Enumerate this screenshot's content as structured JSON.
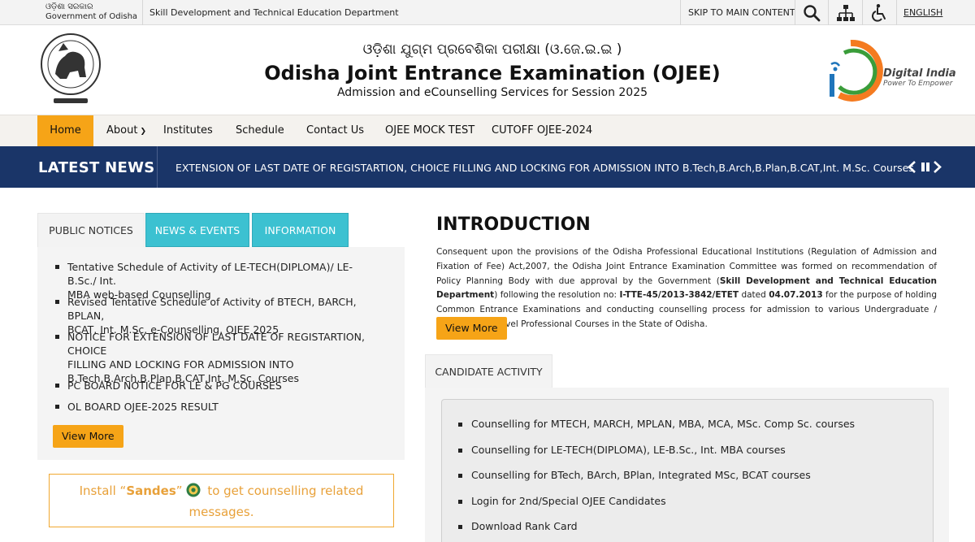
{
  "topbar": {
    "gov_odia": "ଓଡ଼ିଶା ସରକାର",
    "gov_en": "Government of Odisha",
    "department": "Skill Development and Technical Education Department",
    "skip": "SKIP TO MAIN CONTENT",
    "language": "ENGLISH",
    "icons": [
      "search-icon",
      "sitemap-icon",
      "accessibility-icon"
    ]
  },
  "header": {
    "title_odia": "ଓଡ଼ିଶା ଯୁଗ୍ମ ପ୍ରବେଶିକା ପରୀକ୍ଷା (ଓ.ଜେ.ଇ.ଇ )",
    "title": "Odisha Joint Entrance Examination (OJEE)",
    "subtitle": "Admission and eCounselling Services for Session 2025",
    "digital_india": "Digital India",
    "digital_india_tag": "Power To Empower"
  },
  "nav": {
    "items": [
      "Home",
      "About",
      "Institutes",
      "Schedule",
      "Contact Us",
      "OJEE MOCK TEST",
      "CUTOFF OJEE-2024"
    ],
    "active": "Home"
  },
  "ticker": {
    "label": "LATEST NEWS",
    "text": "EXTENSION OF LAST DATE OF REGISTARTION, CHOICE FILLING AND LOCKING FOR ADMISSION INTO B.Tech,B.Arch,B.Plan,B.CAT,Int. M.Sc. Courses",
    "controls": [
      "prev-icon",
      "pause-icon",
      "next-icon"
    ]
  },
  "left": {
    "tabs": [
      "PUBLIC NOTICES",
      "NEWS & EVENTS",
      "INFORMATION"
    ],
    "notices": [
      [
        "Tentative Schedule of Activity of LE-TECH(DIPLOMA)/ LE-B.Sc./ Int.",
        "MBA web-based Counselling"
      ],
      [
        "Revised Tentative Schedule of Activity of BTECH, BARCH, BPLAN,",
        "BCAT, Int. M.Sc. e-Counselling, OJEE 2025"
      ],
      [
        "NOTICE FOR EXTENSION OF LAST DATE OF REGISTARTION, CHOICE",
        "FILLING AND LOCKING FOR ADMISSION INTO",
        "B.Tech,B.Arch,B.Plan,B.CAT,Int. M.Sc. Courses"
      ],
      [
        "PC BOARD NOTICE FOR LE & PG COURSES"
      ],
      [
        "OL BOARD OJEE-2025 RESULT"
      ]
    ],
    "view_more": "View More",
    "sandes": {
      "pre": "Install “",
      "name": "Sandes",
      "mid": "”",
      "post": " to get counselling related",
      "line2": "messages."
    }
  },
  "intro": {
    "title": "INTRODUCTION",
    "text_1": "Consequent upon the provisions of the Odisha Professional Educational Institutions (Regulation of Admission and Fixation of Fee) Act,2007, the Odisha Joint Entrance Examination Committee was formed on recommendation of Policy Planning Body with due approval by the Government (",
    "bold_1": "Skill Development and Technical Education Department",
    "text_2": ") following the resolution no: ",
    "bold_2": "I-TTE-45/2013-3842/ETET",
    "text_3": " dated ",
    "bold_3": "04.07.2013",
    "text_4": " for the purpose of holding Common Entrance Examinations and conducting counselling process for admission to various Undergraduate / Postgraduate Level Professional Courses in the State of Odisha.",
    "view_more": "View More"
  },
  "candidate": {
    "tab": "CANDIDATE ACTIVITY",
    "items": [
      "Counselling for MTECH, MARCH, MPLAN, MBA, MCA, MSc. Comp Sc. courses",
      "Counselling for LE-TECH(DIPLOMA), LE-B.Sc., Int. MBA courses",
      "Counselling for BTech, BArch, BPlan, Integrated MSc, BCAT courses",
      "Login for 2nd/Special OJEE Candidates",
      "Download Rank Card"
    ]
  },
  "colors": {
    "accent_orange": "#f6a417",
    "ticker_navy": "#1a3568",
    "tab_teal": "#3cc1d1",
    "sandes_text": "#e8a13a"
  }
}
